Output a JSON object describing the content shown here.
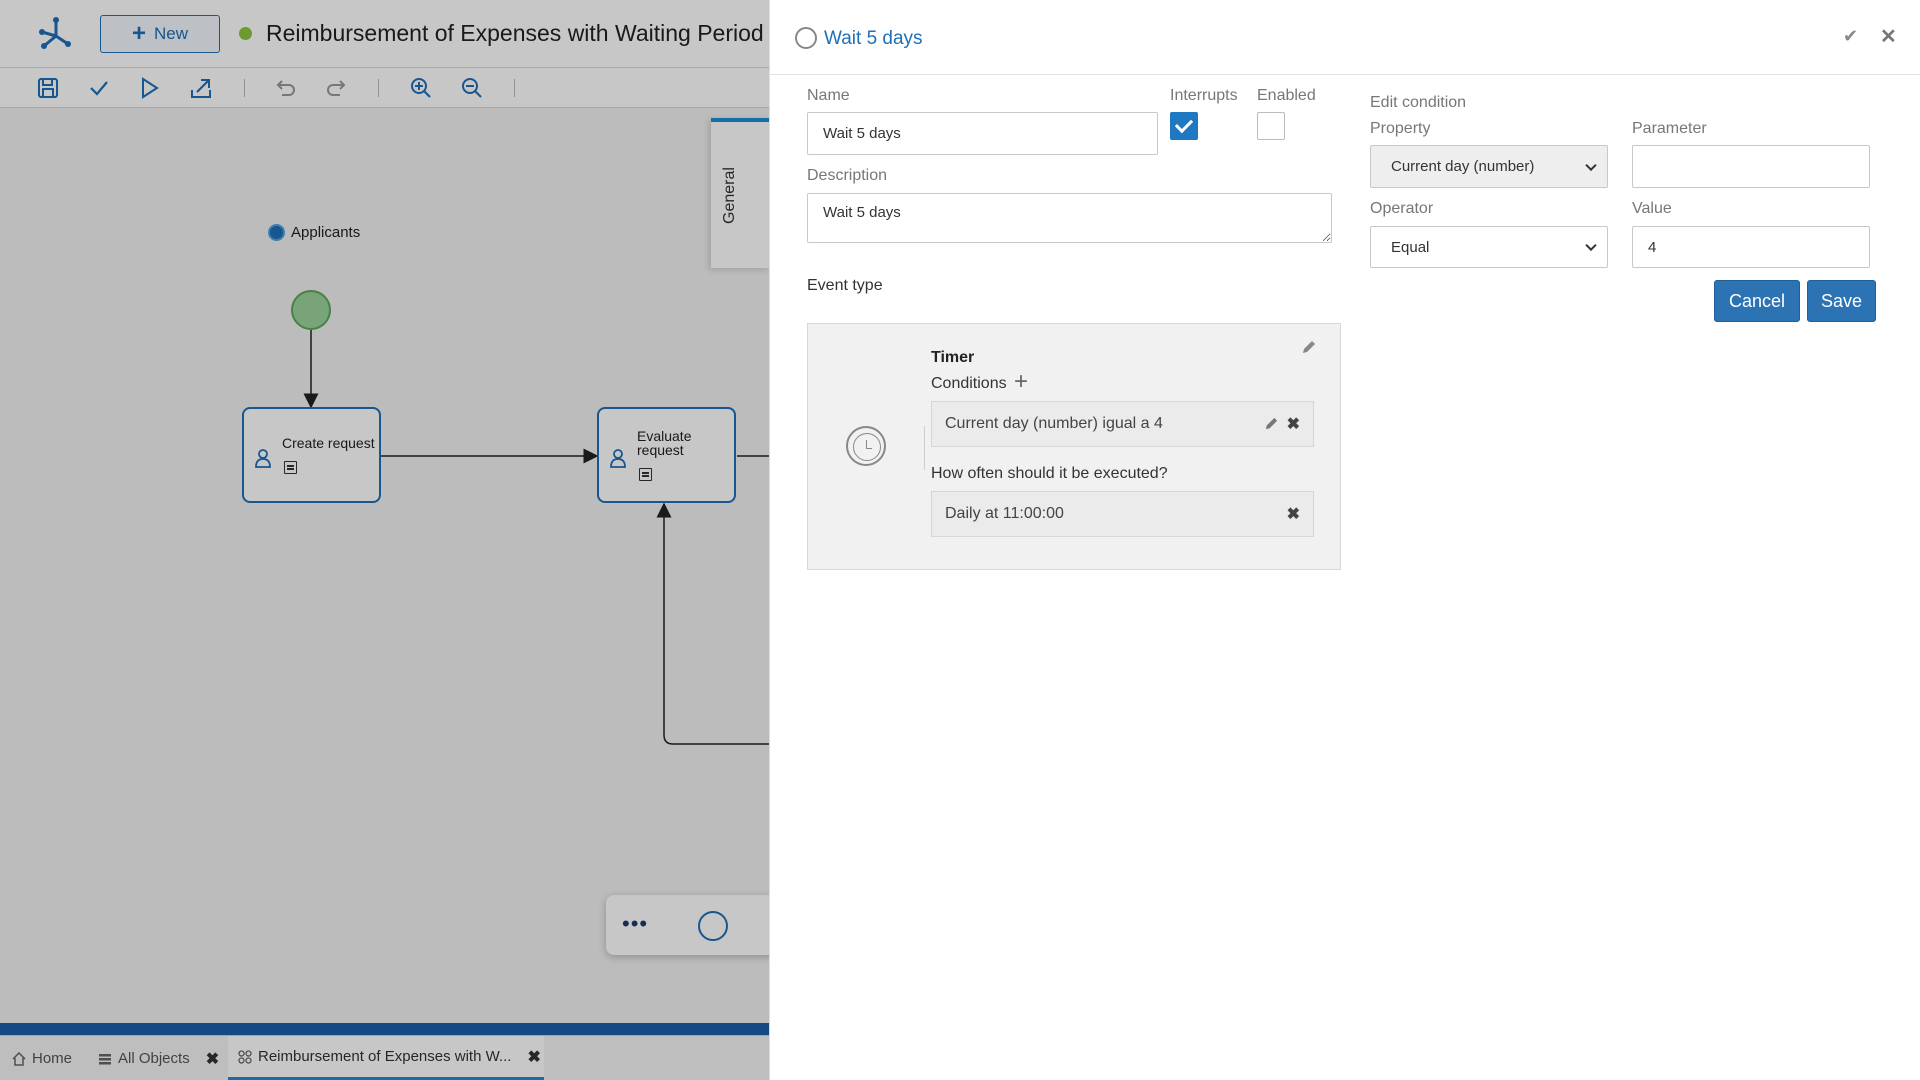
{
  "app": {
    "new_label": "New",
    "doc_title": "Reimbursement of Expenses with Waiting Period",
    "side_tab": "General",
    "lane_label": "Applicants",
    "tasks": [
      {
        "label_line1": "Create request",
        "label_line2": ""
      },
      {
        "label_line1": "Evaluate",
        "label_line2": "request"
      }
    ],
    "palette_dots": "•••",
    "bottom_tabs": [
      {
        "label": "Home"
      },
      {
        "label": "All Objects"
      },
      {
        "label": "Reimbursement of Expenses with W..."
      }
    ]
  },
  "panel": {
    "title": "Wait 5 days",
    "name_label": "Name",
    "name_value": "Wait 5 days",
    "interrupts_label": "Interrupts",
    "interrupts_checked": true,
    "enabled_label": "Enabled",
    "enabled_checked": false,
    "description_label": "Description",
    "description_value": "Wait 5 days",
    "event_type_label": "Event type",
    "timer": {
      "title": "Timer",
      "conditions_label": "Conditions",
      "condition_text": "Current day (number) igual a 4",
      "frequency_label": "How often should it be executed?",
      "frequency_text": "Daily at 11:00:00"
    },
    "edit_condition": {
      "heading": "Edit condition",
      "property_label": "Property",
      "property_value": "Current day (number)",
      "parameter_label": "Parameter",
      "parameter_value": "",
      "operator_label": "Operator",
      "operator_value": "Equal",
      "value_label": "Value",
      "value_value": "4",
      "cancel_label": "Cancel",
      "save_label": "Save"
    }
  },
  "colors": {
    "accent": "#1e6fb8",
    "button": "#2c73b4",
    "status_dot": "#8cc63f",
    "start_event": "#9cd39c"
  }
}
